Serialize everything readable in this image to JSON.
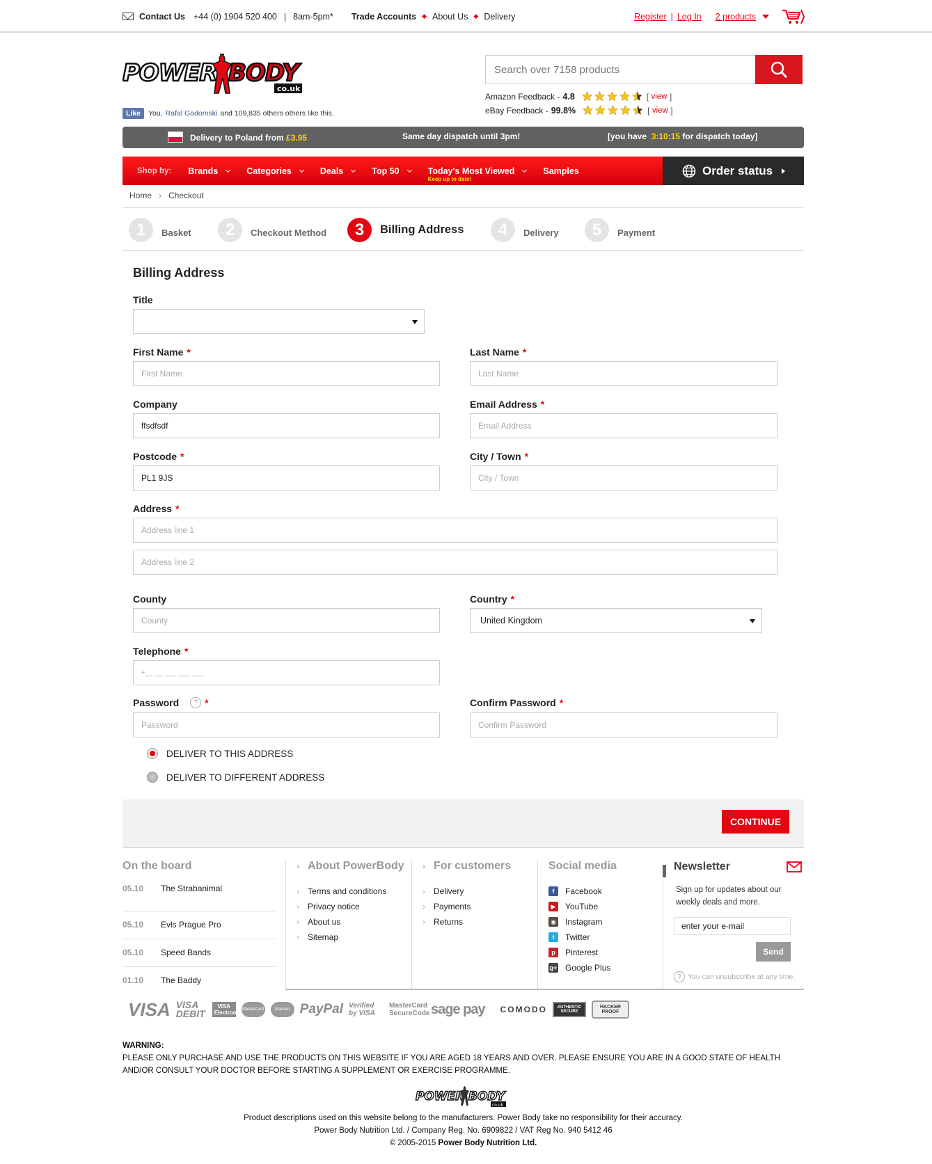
{
  "topbar": {
    "contact_label": "Contact Us",
    "phone": "+44 (0) 1904 520 400",
    "hours": "8am-5pm*",
    "trade": "Trade Accounts",
    "about": "About Us",
    "delivery": "Delivery",
    "register": "Register",
    "login": "Log In",
    "cart": "2 products"
  },
  "header": {
    "logo_text": "POWER BODY",
    "logo_sub": "co.uk",
    "fb_like": "Like",
    "fb_text_you": "You,",
    "fb_name": "Rafal Gadomski",
    "fb_text_rest": "and 109,835 others others like this.",
    "search_placeholder": "Search over 7158 products",
    "amazon_label": "Amazon Feedback -",
    "amazon_score": "4.8",
    "ebay_label": "eBay Feedback -",
    "ebay_score": "99.8%",
    "view": "view"
  },
  "delivery_bar": {
    "to_country": "Delivery to Poland from",
    "price": "£3.95",
    "same_day": "Same day dispatch until 3pm!",
    "you_have": "[you have",
    "timer": "3:10:15",
    "dispatch": "for dispatch today]"
  },
  "nav": {
    "shop_by": "Shop by:",
    "items": [
      "Brands",
      "Categories",
      "Deals",
      "Top 50",
      "Today's Most Viewed",
      "Samples"
    ],
    "most_viewed_sub": "Keep up to date!",
    "order_status": "Order status"
  },
  "breadcrumb": [
    "Home",
    "Checkout"
  ],
  "steps": [
    {
      "num": "1",
      "label": "Basket"
    },
    {
      "num": "2",
      "label": "Checkout Method"
    },
    {
      "num": "3",
      "label": "Billing Address"
    },
    {
      "num": "4",
      "label": "Delivery"
    },
    {
      "num": "5",
      "label": "Payment"
    }
  ],
  "form": {
    "heading": "Billing Address",
    "title_label": "Title",
    "title_value": "",
    "first_name_label": "First Name",
    "first_name_ph": "First Name",
    "last_name_label": "Last Name",
    "last_name_ph": "Last Name",
    "company_label": "Company",
    "company_value": "ffsdfsdf",
    "email_label": "Email Address",
    "email_ph": "Email Address",
    "postcode_label": "Postcode",
    "postcode_value": "PL1 9JS",
    "city_label": "City / Town",
    "city_ph": "City / Town",
    "address_label": "Address",
    "address1_ph": "Address line 1",
    "address2_ph": "Address line 2",
    "county_label": "County",
    "county_ph": "County",
    "country_label": "Country",
    "country_value": "United Kingdom",
    "telephone_label": "Telephone",
    "telephone_ph": "+__ __ ___ ___ ___",
    "password_label": "Password",
    "password_ph": "Password",
    "confirm_label": "Confirm Password",
    "confirm_ph": "Confirm Password",
    "deliver_this": "DELIVER TO THIS ADDRESS",
    "deliver_diff": "DELIVER TO DIFFERENT ADDRESS",
    "continue": "CONTINUE"
  },
  "footer": {
    "board_title": "On the board",
    "board": [
      {
        "date": "05.10",
        "name": "The Strabanimal"
      },
      {
        "date": "05.10",
        "name": "Evls Prague Pro"
      },
      {
        "date": "05.10",
        "name": "Speed Bands"
      },
      {
        "date": "01.10",
        "name": "The Baddy"
      }
    ],
    "about_title": "About PowerBody",
    "about": [
      "Terms and conditions",
      "Privacy notice",
      "About us",
      "Sitemap"
    ],
    "customers_title": "For customers",
    "customers": [
      "Delivery",
      "Payments",
      "Returns"
    ],
    "social_title": "Social media",
    "social": [
      {
        "name": "Facebook",
        "icon": "facebook-icon",
        "color": "#3b5998",
        "glyph": "f"
      },
      {
        "name": "YouTube",
        "icon": "youtube-icon",
        "color": "#cc181e",
        "glyph": "▶"
      },
      {
        "name": "Instagram",
        "icon": "instagram-icon",
        "color": "#5a4a3f",
        "glyph": "◉"
      },
      {
        "name": "Twitter",
        "icon": "twitter-icon",
        "color": "#2ba9e1",
        "glyph": "t"
      },
      {
        "name": "Pinterest",
        "icon": "pinterest-icon",
        "color": "#cb2027",
        "glyph": "p"
      },
      {
        "name": "Google Plus",
        "icon": "google-plus-icon",
        "color": "#444444",
        "glyph": "g+"
      }
    ],
    "newsletter_title": "Newsletter",
    "newsletter_text": "Sign up for updates about our weekly deals and more.",
    "newsletter_email": "enter your e-mail",
    "newsletter_send": "Send",
    "unsubscribe": "You can unsubscribe at any time.",
    "payment_logos": [
      "VISA",
      "VISA DEBIT",
      "VISA Electron",
      "MasterCard",
      "Maestro",
      "PayPal",
      "Verified by VISA",
      "MasterCard SecureCode",
      "sage pay",
      "COMODO",
      "AUTHENTIC SECURE",
      "HACKER PROOF"
    ],
    "warning_title": "WARNING:",
    "warning_text": "PLEASE ONLY PURCHASE AND USE THE PRODUCTS ON THIS WEBSITE IF YOU ARE AGED 18 YEARS AND OVER. PLEASE ENSURE YOU ARE IN A GOOD STATE OF HEALTH AND/OR CONSULT YOUR DOCTOR BEFORE STARTING A SUPPLEMENT OR EXERCISE PROGRAMME.",
    "disclaimer": "Product descriptions used on this website belong to the manufacturers. Power Body take no responsibility for their accuracy.",
    "company": "Power Body Nutrition Ltd. / Company Reg. No. 6909822 / VAT Reg No. 940 5412 46",
    "copyright_prefix": "© 2005-2015",
    "copyright_name": "Power Body Nutrition Ltd."
  },
  "colors": {
    "accent": "#e30613",
    "dark": "#2a2a2a",
    "bar": "#616161",
    "highlight": "#ffd200"
  }
}
